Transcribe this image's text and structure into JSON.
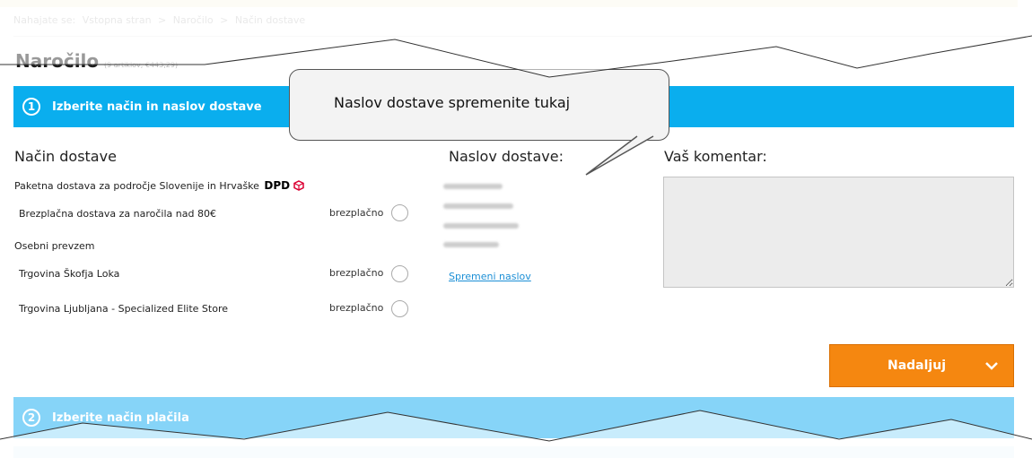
{
  "breadcrumb": [
    "Nahajate se:",
    "Vstopna stran",
    ">",
    "Naročilo",
    ">",
    "Način dostave"
  ],
  "page": {
    "title": "Naročilo",
    "meta": "(9 artiklov, €443,29)"
  },
  "step1": {
    "number": "1",
    "label": "Izberite način in naslov dostave"
  },
  "step2": {
    "number": "2",
    "label": "Izberite način plačila"
  },
  "callout": {
    "text": "Naslov dostave spremenite tukaj"
  },
  "delivery": {
    "heading": "Način dostave",
    "group1": {
      "label": "Paketna dostava za področje Slovenije in Hrvaške",
      "brand": "DPD"
    },
    "option1": {
      "label": "Brezplačna dostava za naročila nad 80€",
      "price": "brezplačno"
    },
    "group2": {
      "label": "Osebni prevzem"
    },
    "option2": {
      "label": "Trgovina Škofja Loka",
      "price": "brezplačno"
    },
    "option3": {
      "label": "Trgovina Ljubljana - Specialized Elite Store",
      "price": "brezplačno"
    }
  },
  "address": {
    "heading": "Naslov dostave:",
    "change_link": "Spremeni naslov"
  },
  "comment": {
    "heading": "Vaš komentar:"
  },
  "continue": {
    "label": "Nadaljuj"
  },
  "colors": {
    "step_active": "#0aaeee",
    "step_inactive": "#86d4f8",
    "button": "#f58710",
    "link": "#1c8fd6"
  }
}
